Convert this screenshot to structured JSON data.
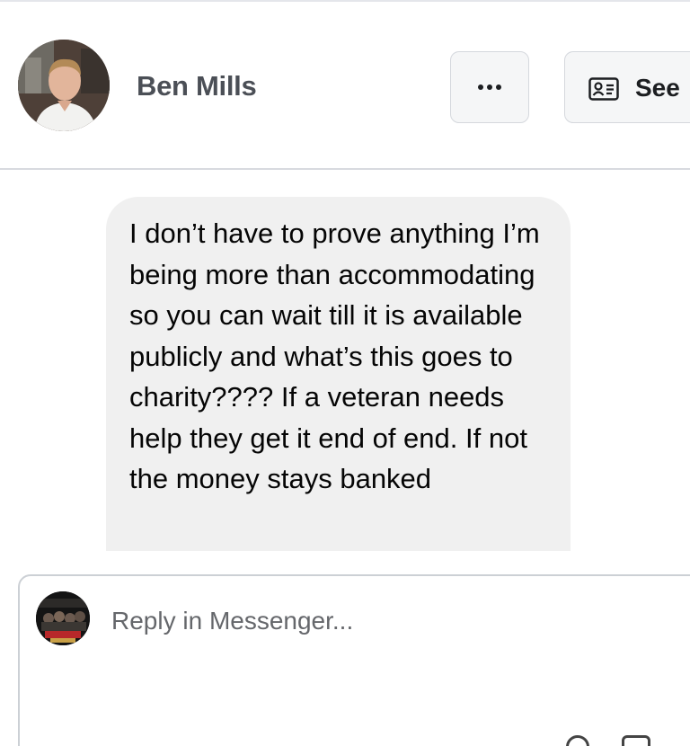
{
  "header": {
    "contact_name": "Ben Mills",
    "more_icon": "ellipsis-icon",
    "see_profile_label": "See",
    "see_profile_icon": "profile-card-icon"
  },
  "conversation": {
    "messages": [
      {
        "sender": "Ben Mills",
        "text": "I don’t have to prove anything I’m being more than accommodating so you can wait till it is available publicly and what’s this goes to charity???? If a veteran needs help they get it end of end. If not the money stays banked"
      }
    ]
  },
  "composer": {
    "placeholder": "Reply in Messenger..."
  },
  "colors": {
    "bubble_bg": "#f0f0f0",
    "button_bg": "#f5f6f7",
    "name_text": "#4b4f56",
    "border": "#d8dadf"
  }
}
